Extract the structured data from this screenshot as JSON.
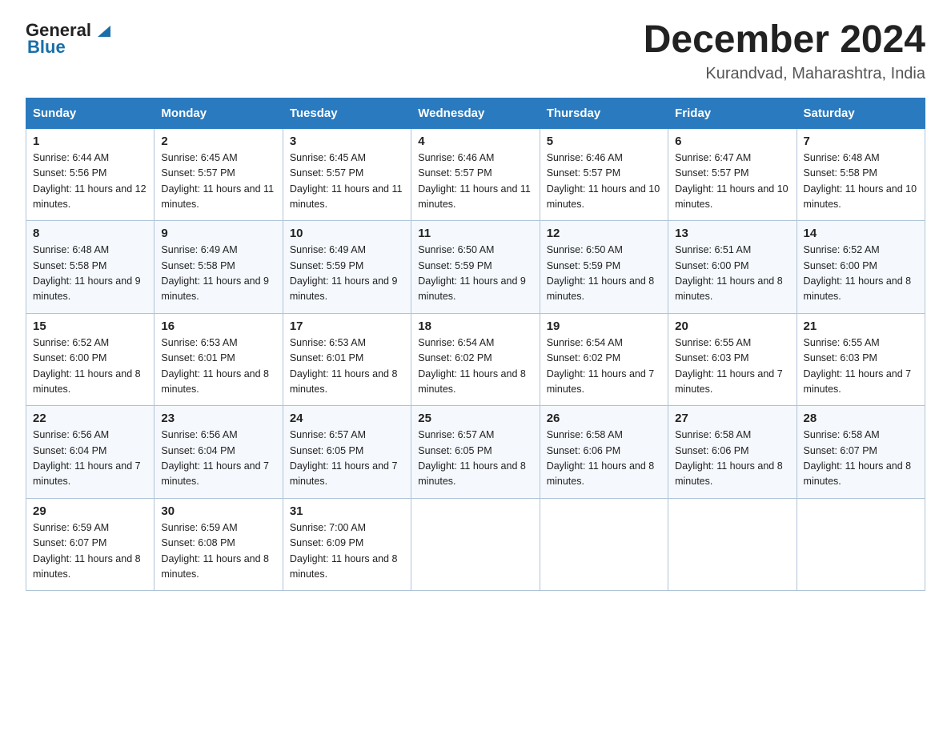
{
  "header": {
    "logo_general": "General",
    "logo_blue": "Blue",
    "month_year": "December 2024",
    "location": "Kurandvad, Maharashtra, India"
  },
  "weekdays": [
    "Sunday",
    "Monday",
    "Tuesday",
    "Wednesday",
    "Thursday",
    "Friday",
    "Saturday"
  ],
  "weeks": [
    [
      {
        "day": "1",
        "sunrise": "6:44 AM",
        "sunset": "5:56 PM",
        "daylight": "11 hours and 12 minutes."
      },
      {
        "day": "2",
        "sunrise": "6:45 AM",
        "sunset": "5:57 PM",
        "daylight": "11 hours and 11 minutes."
      },
      {
        "day": "3",
        "sunrise": "6:45 AM",
        "sunset": "5:57 PM",
        "daylight": "11 hours and 11 minutes."
      },
      {
        "day": "4",
        "sunrise": "6:46 AM",
        "sunset": "5:57 PM",
        "daylight": "11 hours and 11 minutes."
      },
      {
        "day": "5",
        "sunrise": "6:46 AM",
        "sunset": "5:57 PM",
        "daylight": "11 hours and 10 minutes."
      },
      {
        "day": "6",
        "sunrise": "6:47 AM",
        "sunset": "5:57 PM",
        "daylight": "11 hours and 10 minutes."
      },
      {
        "day": "7",
        "sunrise": "6:48 AM",
        "sunset": "5:58 PM",
        "daylight": "11 hours and 10 minutes."
      }
    ],
    [
      {
        "day": "8",
        "sunrise": "6:48 AM",
        "sunset": "5:58 PM",
        "daylight": "11 hours and 9 minutes."
      },
      {
        "day": "9",
        "sunrise": "6:49 AM",
        "sunset": "5:58 PM",
        "daylight": "11 hours and 9 minutes."
      },
      {
        "day": "10",
        "sunrise": "6:49 AM",
        "sunset": "5:59 PM",
        "daylight": "11 hours and 9 minutes."
      },
      {
        "day": "11",
        "sunrise": "6:50 AM",
        "sunset": "5:59 PM",
        "daylight": "11 hours and 9 minutes."
      },
      {
        "day": "12",
        "sunrise": "6:50 AM",
        "sunset": "5:59 PM",
        "daylight": "11 hours and 8 minutes."
      },
      {
        "day": "13",
        "sunrise": "6:51 AM",
        "sunset": "6:00 PM",
        "daylight": "11 hours and 8 minutes."
      },
      {
        "day": "14",
        "sunrise": "6:52 AM",
        "sunset": "6:00 PM",
        "daylight": "11 hours and 8 minutes."
      }
    ],
    [
      {
        "day": "15",
        "sunrise": "6:52 AM",
        "sunset": "6:00 PM",
        "daylight": "11 hours and 8 minutes."
      },
      {
        "day": "16",
        "sunrise": "6:53 AM",
        "sunset": "6:01 PM",
        "daylight": "11 hours and 8 minutes."
      },
      {
        "day": "17",
        "sunrise": "6:53 AM",
        "sunset": "6:01 PM",
        "daylight": "11 hours and 8 minutes."
      },
      {
        "day": "18",
        "sunrise": "6:54 AM",
        "sunset": "6:02 PM",
        "daylight": "11 hours and 8 minutes."
      },
      {
        "day": "19",
        "sunrise": "6:54 AM",
        "sunset": "6:02 PM",
        "daylight": "11 hours and 7 minutes."
      },
      {
        "day": "20",
        "sunrise": "6:55 AM",
        "sunset": "6:03 PM",
        "daylight": "11 hours and 7 minutes."
      },
      {
        "day": "21",
        "sunrise": "6:55 AM",
        "sunset": "6:03 PM",
        "daylight": "11 hours and 7 minutes."
      }
    ],
    [
      {
        "day": "22",
        "sunrise": "6:56 AM",
        "sunset": "6:04 PM",
        "daylight": "11 hours and 7 minutes."
      },
      {
        "day": "23",
        "sunrise": "6:56 AM",
        "sunset": "6:04 PM",
        "daylight": "11 hours and 7 minutes."
      },
      {
        "day": "24",
        "sunrise": "6:57 AM",
        "sunset": "6:05 PM",
        "daylight": "11 hours and 7 minutes."
      },
      {
        "day": "25",
        "sunrise": "6:57 AM",
        "sunset": "6:05 PM",
        "daylight": "11 hours and 8 minutes."
      },
      {
        "day": "26",
        "sunrise": "6:58 AM",
        "sunset": "6:06 PM",
        "daylight": "11 hours and 8 minutes."
      },
      {
        "day": "27",
        "sunrise": "6:58 AM",
        "sunset": "6:06 PM",
        "daylight": "11 hours and 8 minutes."
      },
      {
        "day": "28",
        "sunrise": "6:58 AM",
        "sunset": "6:07 PM",
        "daylight": "11 hours and 8 minutes."
      }
    ],
    [
      {
        "day": "29",
        "sunrise": "6:59 AM",
        "sunset": "6:07 PM",
        "daylight": "11 hours and 8 minutes."
      },
      {
        "day": "30",
        "sunrise": "6:59 AM",
        "sunset": "6:08 PM",
        "daylight": "11 hours and 8 minutes."
      },
      {
        "day": "31",
        "sunrise": "7:00 AM",
        "sunset": "6:09 PM",
        "daylight": "11 hours and 8 minutes."
      },
      null,
      null,
      null,
      null
    ]
  ],
  "labels": {
    "sunrise": "Sunrise:",
    "sunset": "Sunset:",
    "daylight": "Daylight:"
  }
}
